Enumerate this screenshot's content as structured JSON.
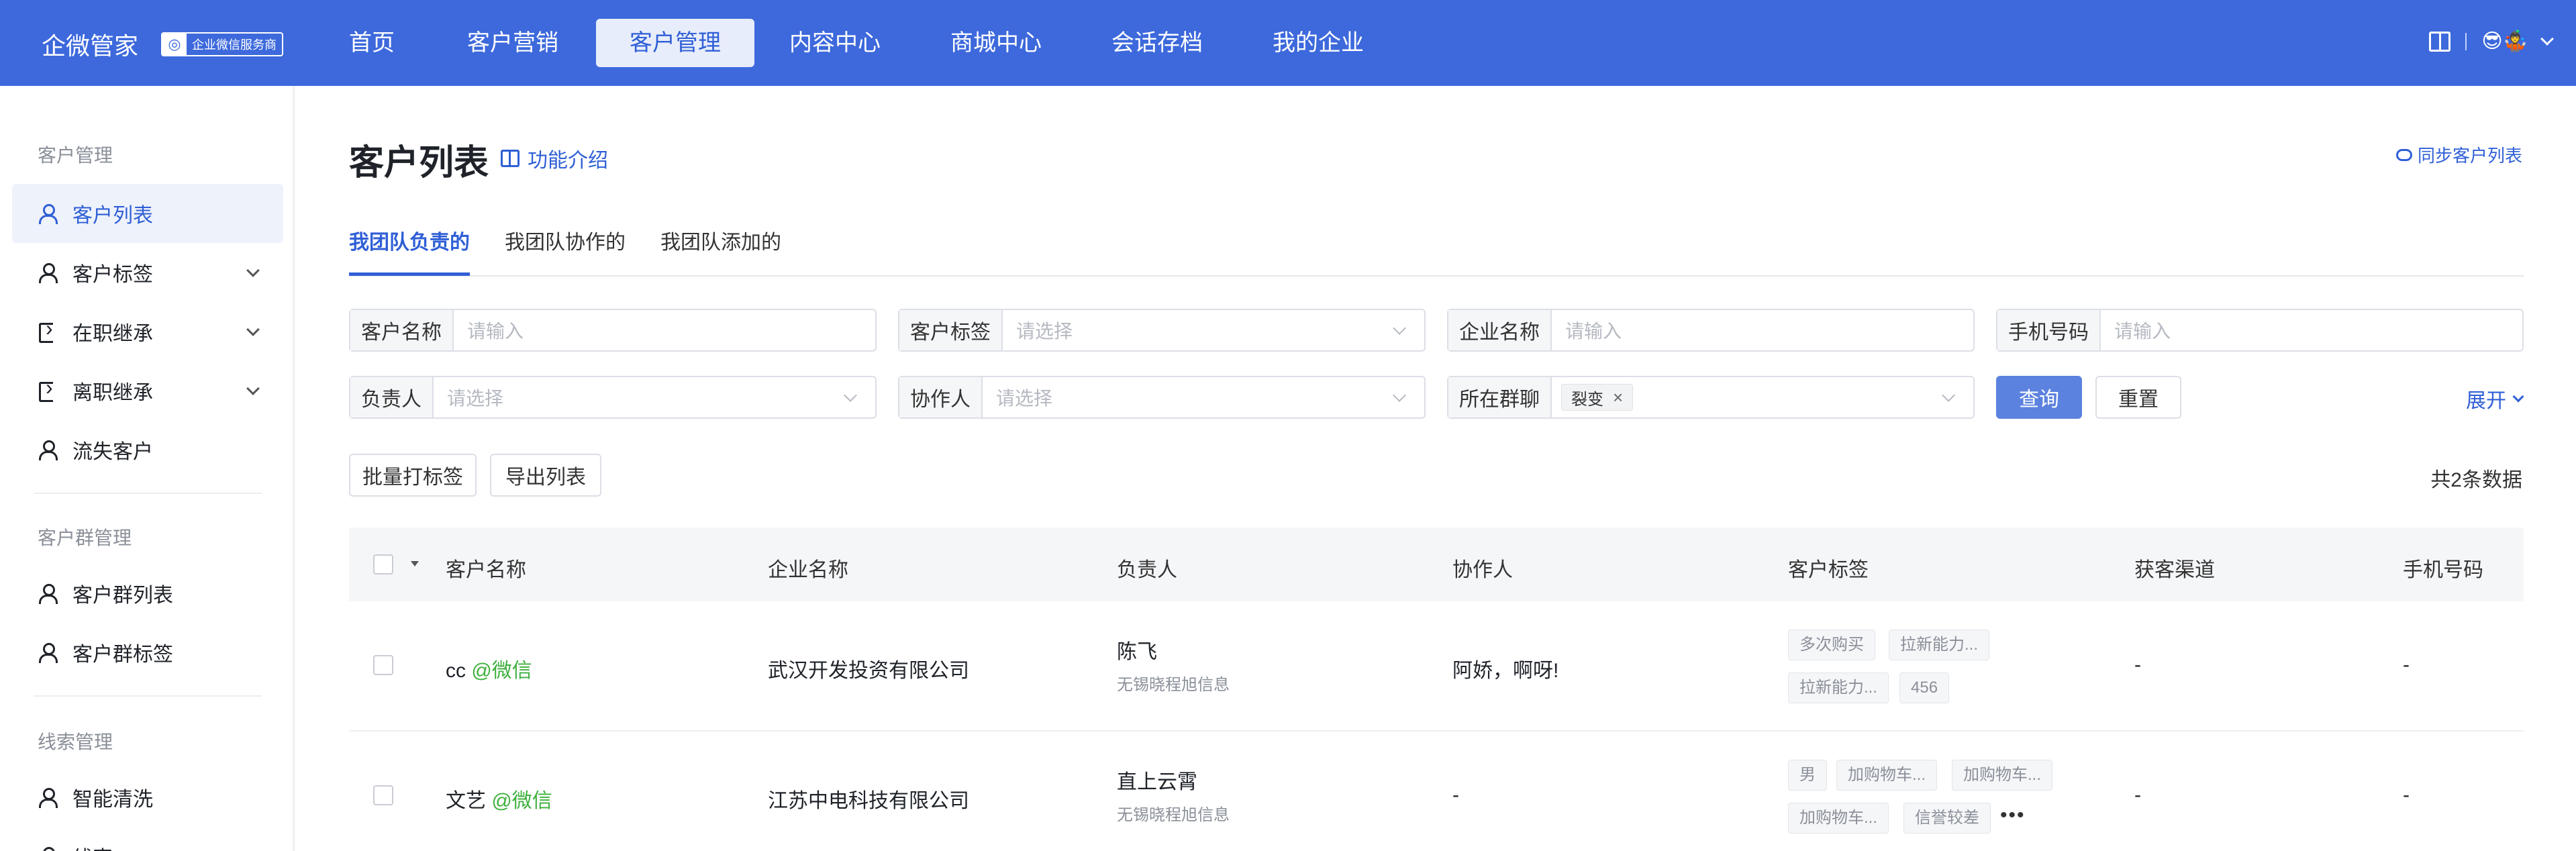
{
  "topbar": {
    "brand": "企微管家",
    "brand_tag": "企业微信服务商",
    "nav": [
      "首页",
      "客户营销",
      "客户管理",
      "内容中心",
      "商城中心",
      "会话存档",
      "我的企业"
    ],
    "active_nav": "客户管理",
    "user_avatar": "😎🤹"
  },
  "sidebar": {
    "groups": [
      "客户管理",
      "客户群管理",
      "线索管理"
    ],
    "items": [
      "客户列表",
      "客户标签",
      "在职继承",
      "离职继承",
      "流失客户",
      "客户群列表",
      "客户群标签",
      "智能清洗",
      "线索"
    ]
  },
  "page": {
    "title": "客户列表",
    "intro": "功能介绍",
    "sync": "同步客户列表",
    "tabs": [
      "我团队负责的",
      "我团队协作的",
      "我团队添加的"
    ]
  },
  "filters": {
    "customer_name": {
      "label": "客户名称",
      "placeholder": "请输入"
    },
    "customer_tag": {
      "label": "客户标签",
      "placeholder": "请选择"
    },
    "company_name": {
      "label": "企业名称",
      "placeholder": "请输入"
    },
    "phone": {
      "label": "手机号码",
      "placeholder": "请输入"
    },
    "owner": {
      "label": "负责人",
      "placeholder": "请选择"
    },
    "collaborator": {
      "label": "协作人",
      "placeholder": "请选择"
    },
    "group": {
      "label": "所在群聊",
      "chip": "裂变",
      "chip_close": "×"
    },
    "query": "查询",
    "reset": "重置",
    "expand": "展开"
  },
  "actions": {
    "batch_tag": "批量打标签",
    "export": "导出列表",
    "total": "共2条数据"
  },
  "table": {
    "headers": [
      "客户名称",
      "企业名称",
      "负责人",
      "协作人",
      "客户标签",
      "获客渠道",
      "手机号码"
    ],
    "rows": [
      {
        "name": "cc",
        "wx": "@微信",
        "company": "武汉开发投资有限公司",
        "owner": "陈飞",
        "owner_sub": "无锡晓程旭信息",
        "collab": "阿娇，啊呀!",
        "tags": [
          "多次购买",
          "拉新能力...",
          "拉新能力...",
          "456"
        ],
        "channel": "-",
        "phone": "-"
      },
      {
        "name": "文艺",
        "wx": "@微信",
        "company": "江苏中电科技有限公司",
        "owner": "直上云霄",
        "owner_sub": "无锡晓程旭信息",
        "collab": "-",
        "tags": [
          "男",
          "加购物车...",
          "加购物车...",
          "加购物车...",
          "信誉较差"
        ],
        "more": "•••",
        "channel": "-",
        "phone": "-"
      }
    ]
  }
}
